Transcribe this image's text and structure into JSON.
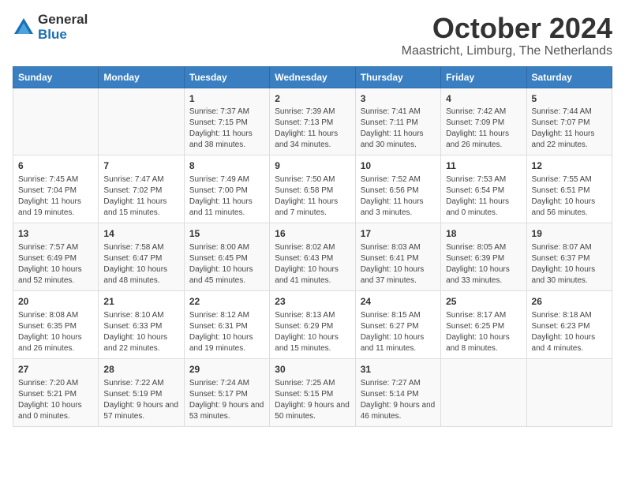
{
  "logo": {
    "general": "General",
    "blue": "Blue"
  },
  "title": "October 2024",
  "subtitle": "Maastricht, Limburg, The Netherlands",
  "days_of_week": [
    "Sunday",
    "Monday",
    "Tuesday",
    "Wednesday",
    "Thursday",
    "Friday",
    "Saturday"
  ],
  "weeks": [
    [
      {
        "day": null,
        "info": ""
      },
      {
        "day": null,
        "info": ""
      },
      {
        "day": "1",
        "info": "Sunrise: 7:37 AM\nSunset: 7:15 PM\nDaylight: 11 hours and 38 minutes."
      },
      {
        "day": "2",
        "info": "Sunrise: 7:39 AM\nSunset: 7:13 PM\nDaylight: 11 hours and 34 minutes."
      },
      {
        "day": "3",
        "info": "Sunrise: 7:41 AM\nSunset: 7:11 PM\nDaylight: 11 hours and 30 minutes."
      },
      {
        "day": "4",
        "info": "Sunrise: 7:42 AM\nSunset: 7:09 PM\nDaylight: 11 hours and 26 minutes."
      },
      {
        "day": "5",
        "info": "Sunrise: 7:44 AM\nSunset: 7:07 PM\nDaylight: 11 hours and 22 minutes."
      }
    ],
    [
      {
        "day": "6",
        "info": "Sunrise: 7:45 AM\nSunset: 7:04 PM\nDaylight: 11 hours and 19 minutes."
      },
      {
        "day": "7",
        "info": "Sunrise: 7:47 AM\nSunset: 7:02 PM\nDaylight: 11 hours and 15 minutes."
      },
      {
        "day": "8",
        "info": "Sunrise: 7:49 AM\nSunset: 7:00 PM\nDaylight: 11 hours and 11 minutes."
      },
      {
        "day": "9",
        "info": "Sunrise: 7:50 AM\nSunset: 6:58 PM\nDaylight: 11 hours and 7 minutes."
      },
      {
        "day": "10",
        "info": "Sunrise: 7:52 AM\nSunset: 6:56 PM\nDaylight: 11 hours and 3 minutes."
      },
      {
        "day": "11",
        "info": "Sunrise: 7:53 AM\nSunset: 6:54 PM\nDaylight: 11 hours and 0 minutes."
      },
      {
        "day": "12",
        "info": "Sunrise: 7:55 AM\nSunset: 6:51 PM\nDaylight: 10 hours and 56 minutes."
      }
    ],
    [
      {
        "day": "13",
        "info": "Sunrise: 7:57 AM\nSunset: 6:49 PM\nDaylight: 10 hours and 52 minutes."
      },
      {
        "day": "14",
        "info": "Sunrise: 7:58 AM\nSunset: 6:47 PM\nDaylight: 10 hours and 48 minutes."
      },
      {
        "day": "15",
        "info": "Sunrise: 8:00 AM\nSunset: 6:45 PM\nDaylight: 10 hours and 45 minutes."
      },
      {
        "day": "16",
        "info": "Sunrise: 8:02 AM\nSunset: 6:43 PM\nDaylight: 10 hours and 41 minutes."
      },
      {
        "day": "17",
        "info": "Sunrise: 8:03 AM\nSunset: 6:41 PM\nDaylight: 10 hours and 37 minutes."
      },
      {
        "day": "18",
        "info": "Sunrise: 8:05 AM\nSunset: 6:39 PM\nDaylight: 10 hours and 33 minutes."
      },
      {
        "day": "19",
        "info": "Sunrise: 8:07 AM\nSunset: 6:37 PM\nDaylight: 10 hours and 30 minutes."
      }
    ],
    [
      {
        "day": "20",
        "info": "Sunrise: 8:08 AM\nSunset: 6:35 PM\nDaylight: 10 hours and 26 minutes."
      },
      {
        "day": "21",
        "info": "Sunrise: 8:10 AM\nSunset: 6:33 PM\nDaylight: 10 hours and 22 minutes."
      },
      {
        "day": "22",
        "info": "Sunrise: 8:12 AM\nSunset: 6:31 PM\nDaylight: 10 hours and 19 minutes."
      },
      {
        "day": "23",
        "info": "Sunrise: 8:13 AM\nSunset: 6:29 PM\nDaylight: 10 hours and 15 minutes."
      },
      {
        "day": "24",
        "info": "Sunrise: 8:15 AM\nSunset: 6:27 PM\nDaylight: 10 hours and 11 minutes."
      },
      {
        "day": "25",
        "info": "Sunrise: 8:17 AM\nSunset: 6:25 PM\nDaylight: 10 hours and 8 minutes."
      },
      {
        "day": "26",
        "info": "Sunrise: 8:18 AM\nSunset: 6:23 PM\nDaylight: 10 hours and 4 minutes."
      }
    ],
    [
      {
        "day": "27",
        "info": "Sunrise: 7:20 AM\nSunset: 5:21 PM\nDaylight: 10 hours and 0 minutes."
      },
      {
        "day": "28",
        "info": "Sunrise: 7:22 AM\nSunset: 5:19 PM\nDaylight: 9 hours and 57 minutes."
      },
      {
        "day": "29",
        "info": "Sunrise: 7:24 AM\nSunset: 5:17 PM\nDaylight: 9 hours and 53 minutes."
      },
      {
        "day": "30",
        "info": "Sunrise: 7:25 AM\nSunset: 5:15 PM\nDaylight: 9 hours and 50 minutes."
      },
      {
        "day": "31",
        "info": "Sunrise: 7:27 AM\nSunset: 5:14 PM\nDaylight: 9 hours and 46 minutes."
      },
      {
        "day": null,
        "info": ""
      },
      {
        "day": null,
        "info": ""
      }
    ]
  ]
}
